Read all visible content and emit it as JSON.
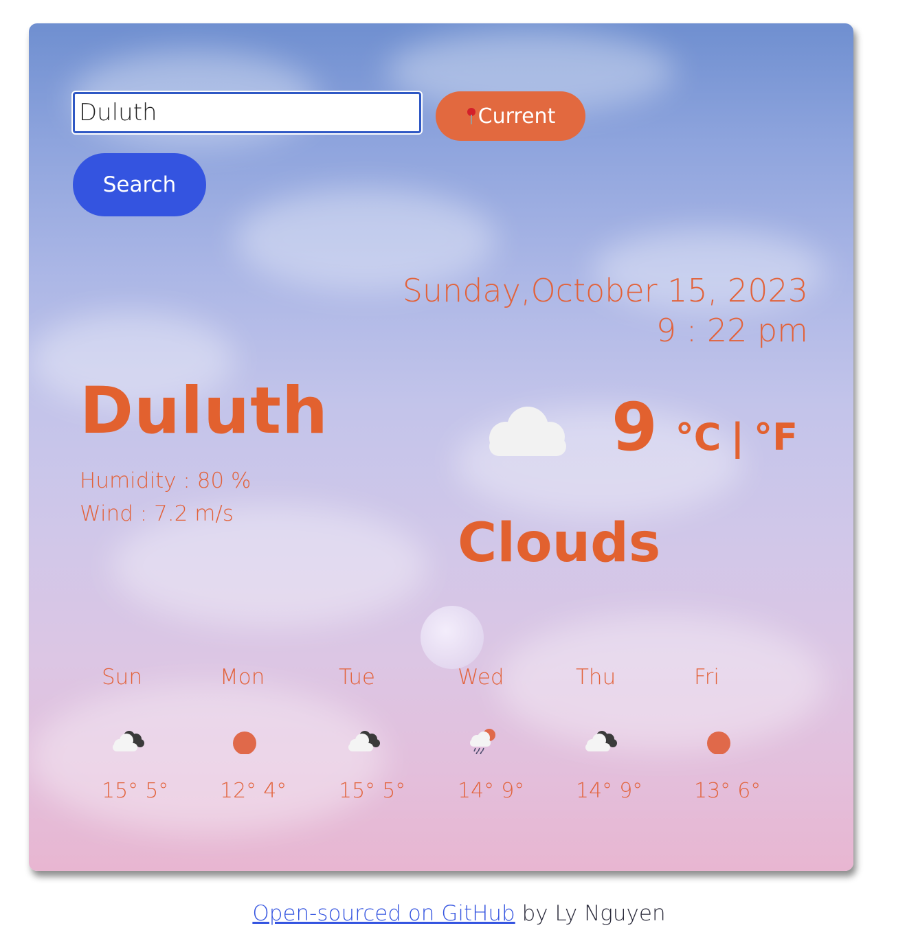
{
  "search": {
    "value": "Duluth",
    "current_label": "Current",
    "search_label": "Search"
  },
  "datetime": {
    "date": "Sunday,October 15, 2023",
    "time": "9 : 22 pm"
  },
  "weather": {
    "city": "Duluth",
    "humidity": "Humidity : 80 %",
    "wind": "Wind : 7.2 m/s",
    "temperature": "9",
    "unit_c": "°C",
    "unit_separator": "|",
    "unit_f": "°F",
    "condition": "Clouds",
    "icon": "cloud-icon"
  },
  "forecast": [
    {
      "day": "Sun",
      "high": "15°",
      "low": "5°",
      "icon": "cloud-dark-icon"
    },
    {
      "day": "Mon",
      "high": "12°",
      "low": "4°",
      "icon": "sun-icon"
    },
    {
      "day": "Tue",
      "high": "15°",
      "low": "5°",
      "icon": "cloud-dark-icon"
    },
    {
      "day": "Wed",
      "high": "14°",
      "low": "9°",
      "icon": "rain-icon"
    },
    {
      "day": "Thu",
      "high": "14°",
      "low": "9°",
      "icon": "cloud-dark-icon"
    },
    {
      "day": "Fri",
      "high": "13°",
      "low": "6°",
      "icon": "sun-icon"
    }
  ],
  "footer": {
    "link_text": "Open-sourced on GitHub",
    "author_text": " by Ly Nguyen"
  },
  "colors": {
    "accent_orange": "#e2612f",
    "button_blue": "#3454e0",
    "current_button": "#e2693f"
  }
}
